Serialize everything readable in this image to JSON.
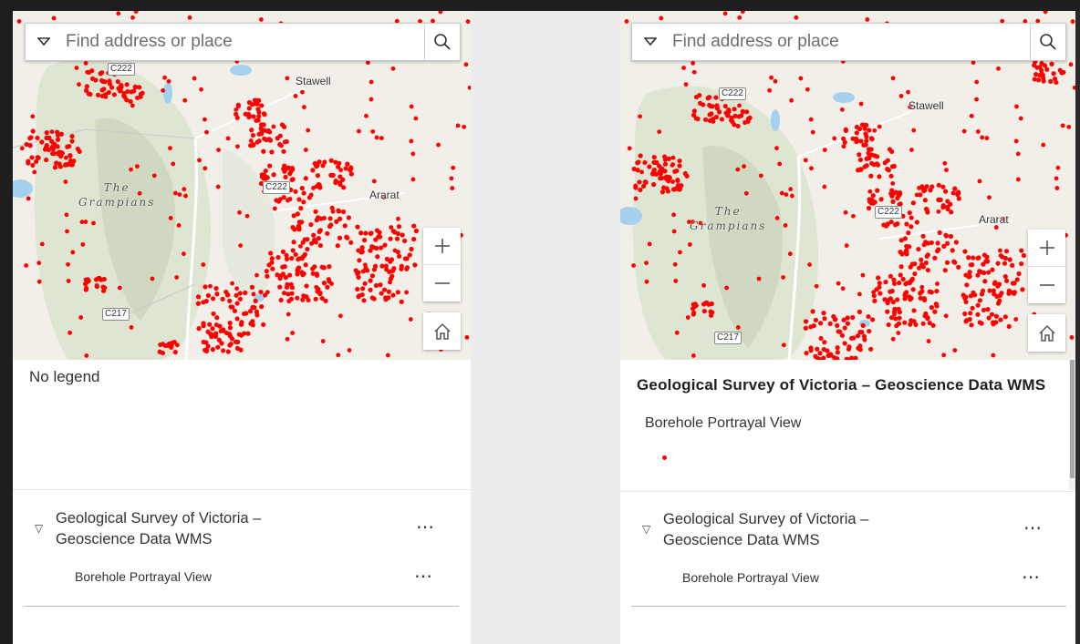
{
  "search": {
    "placeholder": "Find address or place"
  },
  "map": {
    "towns": {
      "stawell": "Stawell",
      "ararat": "Ararat"
    },
    "mountains": {
      "name_line1": "The",
      "name_line2": "Grampians"
    },
    "roads": {
      "c222": "C222",
      "c217": "C217"
    },
    "controls": {
      "zoom_in": "+",
      "zoom_out": "−"
    },
    "colors": {
      "boreholes": "#ff0000",
      "terrain": "#dfe5d3",
      "water": "#a6d1ee"
    }
  },
  "left_panel": {
    "legend_message": "No legend",
    "layer": {
      "title": "Geological Survey of Victoria – Geoscience Data WMS",
      "sublayer": "Borehole Portrayal View"
    }
  },
  "right_panel": {
    "legend": {
      "service_title": "Geological Survey of Victoria – Geoscience Data WMS",
      "layer_name": "Borehole Portrayal View"
    },
    "layer": {
      "title": "Geological Survey of Victoria – Geoscience Data WMS",
      "sublayer": "Borehole Portrayal View"
    }
  },
  "icons": {
    "menu": "⋯",
    "caret": "▽"
  }
}
